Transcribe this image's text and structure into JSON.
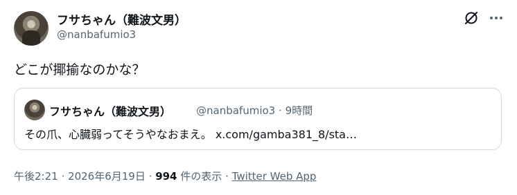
{
  "author": {
    "name": "フサちゃん（難波文男）",
    "handle": "@nanbafumio3"
  },
  "tweet": {
    "text": "どこが揶揄なのかな？"
  },
  "quote": {
    "name": "フサちゃん（難波文男）",
    "handle": "@nanbafumio3",
    "separator": "·",
    "time": "9時間",
    "text": "その爪、心臓弱ってそうやなおまえ。",
    "link": "x.com/gamba381_8/sta…"
  },
  "footer": {
    "timestamp": "午後2:21",
    "sep1": "·",
    "date": "2026年6月19日",
    "sep2": "·",
    "views_count": "994",
    "views_label": "件の表示",
    "sep3": "·",
    "source": "Twitter Web App"
  },
  "icons": {
    "grok": "grok-icon",
    "more": "more-icon"
  },
  "colors": {
    "text": "#0f1419",
    "secondary": "#536471",
    "border": "#cfd9de"
  }
}
